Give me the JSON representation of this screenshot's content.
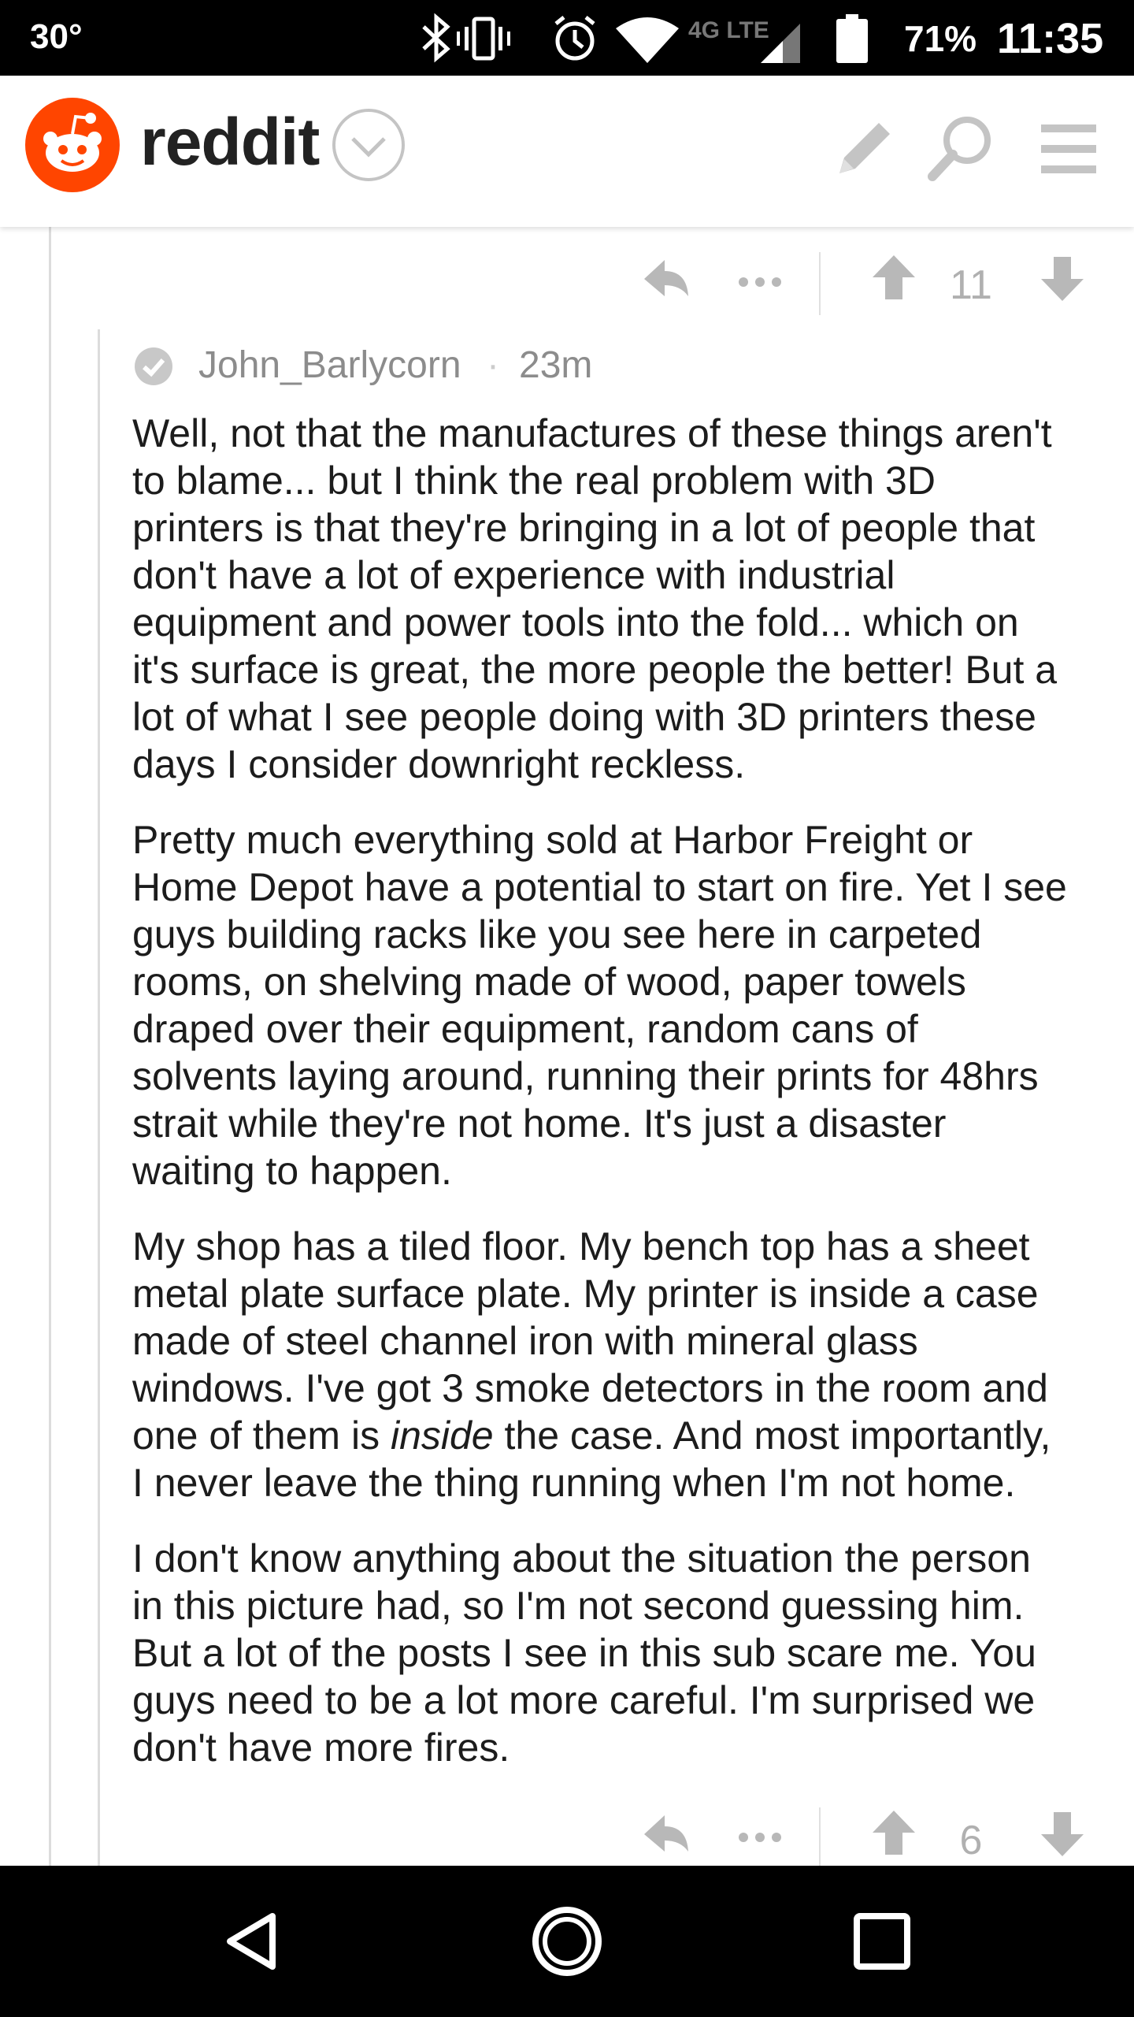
{
  "status_bar": {
    "temperature": "30°",
    "network": "4G LTE",
    "battery": "71%",
    "time": "11:35"
  },
  "header": {
    "app_name": "reddit",
    "icons": [
      "snoo-logo-icon",
      "chevron-down-icon",
      "pencil-icon",
      "search-icon",
      "menu-icon"
    ]
  },
  "parent_actions": {
    "score": "11"
  },
  "comment": {
    "author": "John_Barlycorn",
    "separator": "·",
    "age": "23m",
    "paragraphs": [
      {
        "lines": [
          "Well, not that the manufactures of these things aren't",
          "to blame... but I think the real problem with 3D",
          "printers is that they're bringing in a lot of people that",
          "don't have a lot of experience with industrial",
          "equipment and power tools into the fold... which on",
          "it's surface is great, the more people the better! But a",
          "lot of what I see people doing with 3D printers these",
          "days I consider downright reckless."
        ]
      },
      {
        "lines": [
          "Pretty much everything sold at Harbor Freight or",
          "Home Depot have a potential to start on fire. Yet I see",
          "guys building racks like you see here in carpeted",
          "rooms, on shelving made of wood, paper towels",
          "draped over their equipment, random cans of",
          "solvents laying around, running their prints for 48hrs",
          "strait while they're not home. It's just a disaster",
          "waiting to happen."
        ]
      },
      {
        "lines": [
          "My shop has a tiled floor. My bench top has a sheet",
          "metal plate surface plate. My printer is inside a case",
          "made of steel channel iron with mineral glass",
          "windows. I've got 3 smoke detectors in the room and"
        ],
        "emphasis_line": {
          "before": "one of them is ",
          "em": "inside",
          "after": " the case. And most importantly,"
        },
        "last_line": "I never leave the thing running when I'm not home."
      },
      {
        "lines": [
          "I don't know anything about the situation the person",
          "in this picture had, so I'm not second guessing him.",
          "But a lot of the posts I see in this sub scare me. You",
          "guys need to be a lot more careful. I'm surprised we",
          "don't have more fires."
        ]
      }
    ],
    "actions": {
      "score": "6"
    }
  },
  "nav_bar": {
    "buttons": [
      "back-icon",
      "home-icon",
      "recents-icon"
    ]
  },
  "colors": {
    "reddit_orange": "#ff4500",
    "icon_gray": "#b8b8b8",
    "text": "#1c1c1c",
    "meta_gray": "#8c8c8c"
  }
}
